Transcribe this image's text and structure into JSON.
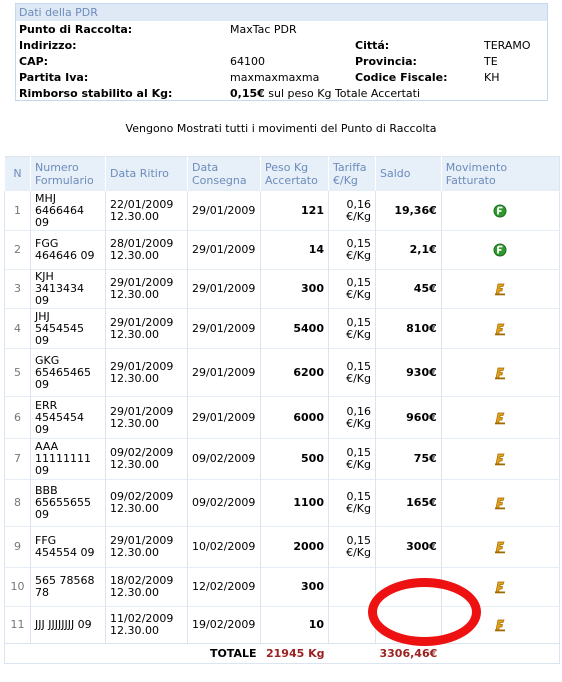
{
  "pdr": {
    "header": "Dati della PDR",
    "punto_label": "Punto di Raccolta:",
    "punto_value": "MaxTac PDR",
    "indirizzo_label": "Indirizzo:",
    "indirizzo_value": "",
    "citta_label": "Cittá:",
    "citta_value": "TERAMO",
    "cap_label": "CAP:",
    "cap_value": "64100",
    "provincia_label": "Provincia:",
    "provincia_value": "TE",
    "piva_label": "Partita Iva:",
    "piva_value": "maxmaxmaxma",
    "cf_label": "Codice Fiscale:",
    "cf_value": "KH",
    "rimborso_label": "Rimborso stabilito al Kg:",
    "rimborso_value": "0,15€",
    "rimborso_note": "sul peso Kg Totale Accertati"
  },
  "intro": "Vengono Mostrati tutti i movimenti del Punto di Raccolta",
  "table": {
    "headers": {
      "n": "N",
      "formulario": "Numero Formulario",
      "ritiro": "Data Ritiro",
      "consegna": "Data Consegna",
      "peso": "Peso Kg Accertato",
      "tariffa": "Tariffa €/Kg",
      "saldo": "Saldo",
      "fatturato": "Movimento Fatturato"
    },
    "rows": [
      {
        "n": "1",
        "form": "MHJ 6466464 09",
        "ritiro": "22/01/2009 12.30.00",
        "consegna": "29/01/2009",
        "peso": "121",
        "tariffa": "0,16 €/Kg",
        "saldo": "19,36€",
        "fatturato": "paid"
      },
      {
        "n": "2",
        "form": "FGG 464646 09",
        "ritiro": "28/01/2009 12.30.00",
        "consegna": "29/01/2009",
        "peso": "14",
        "tariffa": "0,15 €/Kg",
        "saldo": "2,1€",
        "fatturato": "paid"
      },
      {
        "n": "3",
        "form": "KJH 3413434 09",
        "ritiro": "29/01/2009 12.30.00",
        "consegna": "29/01/2009",
        "peso": "300",
        "tariffa": "0,15 €/Kg",
        "saldo": "45€",
        "fatturato": "pending"
      },
      {
        "n": "4",
        "form": "JHJ 5454545 09",
        "ritiro": "29/01/2009 12.30.00",
        "consegna": "29/01/2009",
        "peso": "5400",
        "tariffa": "0,15 €/Kg",
        "saldo": "810€",
        "fatturato": "pending"
      },
      {
        "n": "5",
        "form": "GKG 65465465 09",
        "ritiro": "29/01/2009 12.30.00",
        "consegna": "29/01/2009",
        "peso": "6200",
        "tariffa": "0,15 €/Kg",
        "saldo": "930€",
        "fatturato": "pending"
      },
      {
        "n": "6",
        "form": "ERR 4545454 09",
        "ritiro": "29/01/2009 12.30.00",
        "consegna": "29/01/2009",
        "peso": "6000",
        "tariffa": "0,16 €/Kg",
        "saldo": "960€",
        "fatturato": "pending"
      },
      {
        "n": "7",
        "form": "AAA 11111111 09",
        "ritiro": "09/02/2009 12.30.00",
        "consegna": "09/02/2009",
        "peso": "500",
        "tariffa": "0,15 €/Kg",
        "saldo": "75€",
        "fatturato": "pending"
      },
      {
        "n": "8",
        "form": "BBB 65655655 09",
        "ritiro": "09/02/2009 12.30.00",
        "consegna": "09/02/2009",
        "peso": "1100",
        "tariffa": "0,15 €/Kg",
        "saldo": "165€",
        "fatturato": "pending"
      },
      {
        "n": "9",
        "form": "FFG 454554 09",
        "ritiro": "29/01/2009 12.30.00",
        "consegna": "10/02/2009",
        "peso": "2000",
        "tariffa": "0,15 €/Kg",
        "saldo": "300€",
        "fatturato": "pending"
      },
      {
        "n": "10",
        "form": "565 78568 78",
        "ritiro": "18/02/2009 12.30.00",
        "consegna": "12/02/2009",
        "peso": "300",
        "tariffa": "",
        "saldo": "",
        "fatturato": "pending"
      },
      {
        "n": "11",
        "form": "JJJ JJJJJJJJ 09",
        "ritiro": "11/02/2009 12.30.00",
        "consegna": "19/02/2009",
        "peso": "10",
        "tariffa": "",
        "saldo": "",
        "fatturato": "pending"
      }
    ],
    "total": {
      "label": "TOTALE",
      "peso": "21945 Kg",
      "saldo": "3306,46€"
    }
  },
  "colors": {
    "header_bg": "#e7eff8",
    "header_text": "#6c8cbb",
    "total_red": "#9b2222",
    "annotation_red": "#ee1111",
    "paid_green": "#2e9a2e",
    "pending_orange": "#e6a21a"
  }
}
